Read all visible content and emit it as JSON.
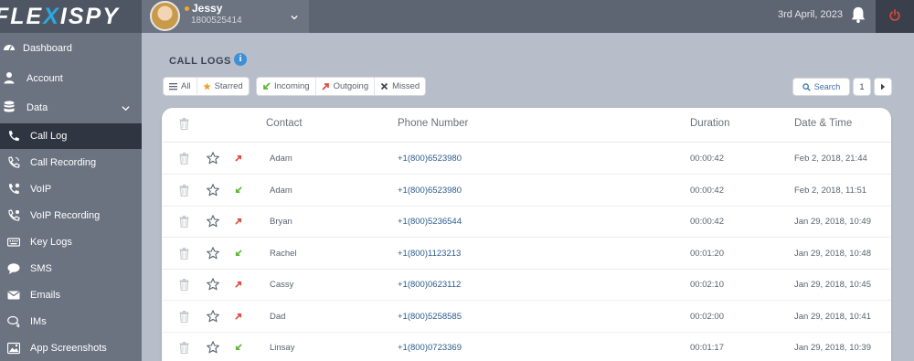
{
  "brand": {
    "logo_left": "FLE",
    "logo_x": "X",
    "logo_right": "ISPY",
    "accent": "#29a8e0"
  },
  "user": {
    "name": "Jessy",
    "phone": "1800525414",
    "status_color": "#f6a623"
  },
  "header": {
    "date": "3rd April, 2023",
    "bell_icon": "bell-icon",
    "power_icon": "power-icon",
    "power_color": "#e0483a"
  },
  "sidebar": {
    "items": [
      {
        "label": "Dashboard",
        "icon": "dashboard-icon"
      },
      {
        "label": "Account",
        "icon": "user-icon"
      },
      {
        "label": "Data",
        "icon": "database-icon",
        "expanded": true
      }
    ],
    "sub_items": [
      {
        "label": "Call Log",
        "icon": "phone-icon",
        "active": true
      },
      {
        "label": "Call Recording",
        "icon": "call-recording-icon"
      },
      {
        "label": "VoIP",
        "icon": "voip-icon"
      },
      {
        "label": "VoIP Recording",
        "icon": "voip-recording-icon"
      },
      {
        "label": "Key Logs",
        "icon": "keyboard-icon"
      },
      {
        "label": "SMS",
        "icon": "sms-icon"
      },
      {
        "label": "Emails",
        "icon": "envelope-icon"
      },
      {
        "label": "IMs",
        "icon": "chat-icon"
      },
      {
        "label": "App Screenshots",
        "icon": "screenshot-icon"
      }
    ]
  },
  "main": {
    "title": "CALL LOGS",
    "filters_a": [
      {
        "label": "All",
        "icon": "list-icon"
      },
      {
        "label": "Starred",
        "icon": "star-icon"
      }
    ],
    "filters_b": [
      {
        "label": "Incoming",
        "icon": "incoming-icon"
      },
      {
        "label": "Outgoing",
        "icon": "outgoing-icon"
      },
      {
        "label": "Missed",
        "icon": "missed-icon"
      }
    ],
    "search_label": "Search",
    "page": "1"
  },
  "table": {
    "columns": [
      "Contact",
      "Phone Number",
      "Duration",
      "Date & Time"
    ],
    "rows": [
      {
        "direction": "outgoing",
        "contact": "Adam",
        "phone": "+1(800)6523980",
        "duration": "00:00:42",
        "datetime": "Feb 2, 2018, 21:44"
      },
      {
        "direction": "incoming",
        "contact": "Adam",
        "phone": "+1(800)6523980",
        "duration": "00:00:42",
        "datetime": "Feb 2, 2018, 11:51"
      },
      {
        "direction": "outgoing",
        "contact": "Bryan",
        "phone": "+1(800)5236544",
        "duration": "00:00:42",
        "datetime": "Jan 29, 2018, 10:49"
      },
      {
        "direction": "incoming",
        "contact": "Rachel",
        "phone": "+1(800)1123213",
        "duration": "00:01:20",
        "datetime": "Jan 29, 2018, 10:48"
      },
      {
        "direction": "outgoing",
        "contact": "Cassy",
        "phone": "+1(800)0623112",
        "duration": "00:02:10",
        "datetime": "Jan 29, 2018, 10:45"
      },
      {
        "direction": "outgoing",
        "contact": "Dad",
        "phone": "+1(800)5258585",
        "duration": "00:02:00",
        "datetime": "Jan 29, 2018, 10:41"
      },
      {
        "direction": "incoming",
        "contact": "Linsay",
        "phone": "+1(800)0723369",
        "duration": "00:01:17",
        "datetime": "Jan 29, 2018, 10:39"
      }
    ]
  },
  "colors": {
    "incoming": "#5cb531",
    "outgoing": "#e0483a",
    "starred": "#f0a030",
    "link": "#2b5b8c"
  }
}
